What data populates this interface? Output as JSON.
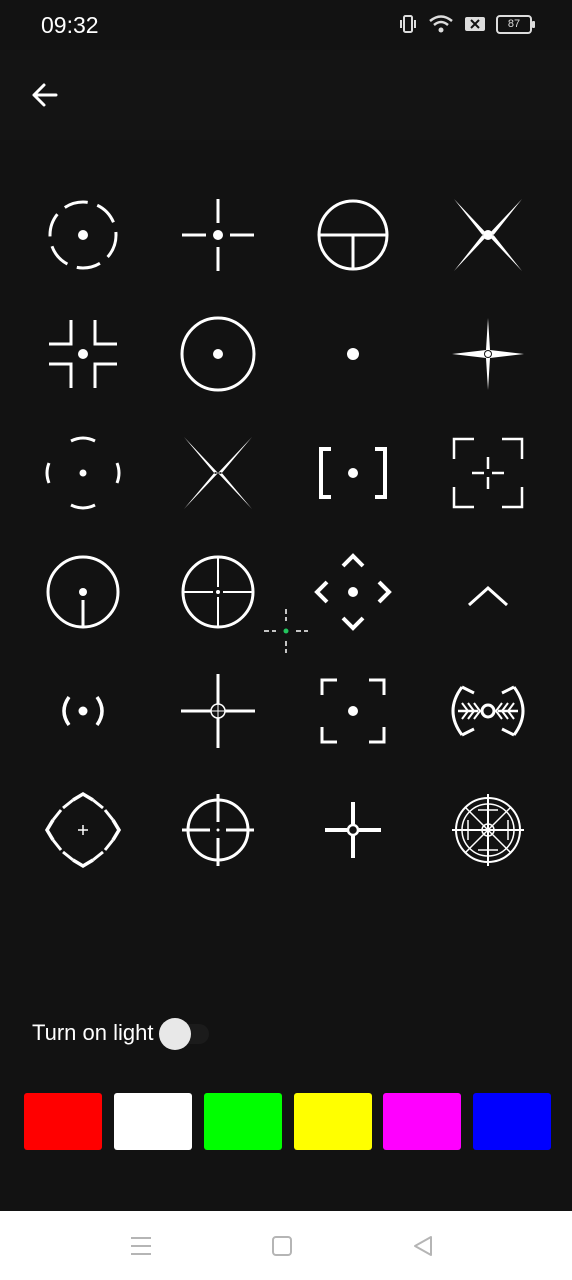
{
  "status": {
    "time": "09:32",
    "battery": "87",
    "icons": [
      "vibrate-icon",
      "wifi-icon",
      "sim-off-icon",
      "battery-icon"
    ]
  },
  "toolbar": {
    "back_icon": "arrow-left-icon"
  },
  "crosshairs": [
    "circle-dashed-dot",
    "cross-gap-dot",
    "circle-tee",
    "x-dot",
    "corner-brackets-dot",
    "circle-dot",
    "dot",
    "star-cross-dot",
    "dashed-ring-dot",
    "x-blades",
    "square-brackets-dot",
    "frame-crosshair",
    "circle-tee-dot",
    "circle-crosshair",
    "diamond-chevrons-dot",
    "chevron-up",
    "parens-dot",
    "cross-small-circle",
    "corner-frame-dot",
    "fishbone-scope",
    "diamond-segments-plus",
    "circle-cross-outer",
    "bold-cross-ring",
    "complex-scope"
  ],
  "preview": {
    "color": "#22c55e"
  },
  "light": {
    "label": "Turn on light",
    "enabled": false
  },
  "colors": [
    "#ff0000",
    "#ffffff",
    "#00ff00",
    "#ffff00",
    "#ff00ff",
    "#0000ff"
  ],
  "nav": {
    "icons": [
      "menu-icon",
      "home-icon",
      "back-icon"
    ]
  }
}
